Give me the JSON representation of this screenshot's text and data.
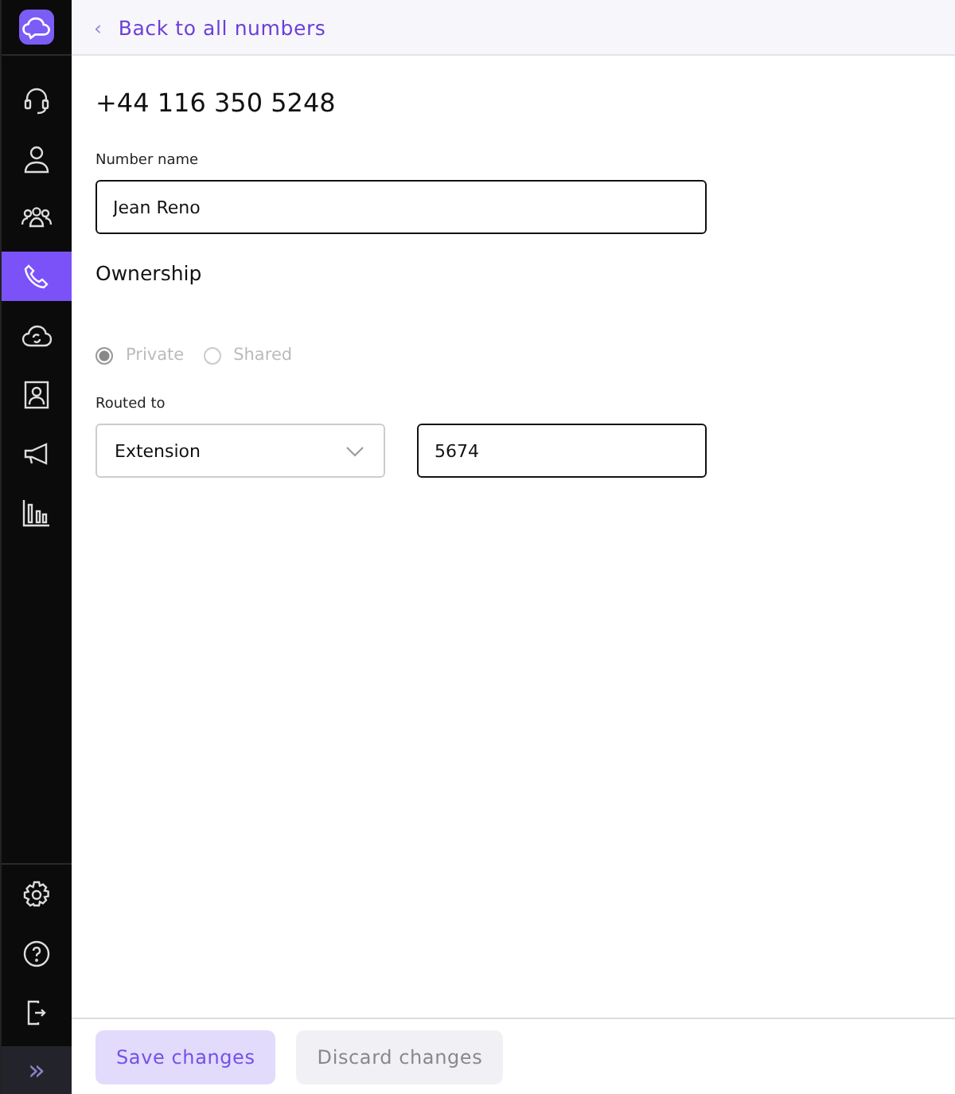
{
  "sidebar": {
    "nav": [
      {
        "kind": "headset",
        "selected": false
      },
      {
        "kind": "person",
        "selected": false
      },
      {
        "kind": "group",
        "selected": false
      },
      {
        "kind": "phone",
        "selected": true
      },
      {
        "kind": "cloud",
        "selected": false
      },
      {
        "kind": "contact",
        "selected": false
      },
      {
        "kind": "megaphone",
        "selected": false
      },
      {
        "kind": "chart",
        "selected": false
      }
    ],
    "bottom": [
      {
        "kind": "settings"
      },
      {
        "kind": "help"
      },
      {
        "kind": "logout"
      }
    ],
    "expand": "»"
  },
  "back_link": {
    "arrow": "‹",
    "label": "Back to all numbers"
  },
  "title": "+44 116 350 5248",
  "number_name": {
    "label": "Number name",
    "value": "Jean Reno"
  },
  "ownership": {
    "heading": "Ownership",
    "disabled": true,
    "options": [
      {
        "label": "Private",
        "selected": true
      },
      {
        "label": "Shared",
        "selected": false
      }
    ]
  },
  "routed_to": {
    "label": "Routed to",
    "type": "Extension",
    "value": "5674"
  },
  "buttons": [
    {
      "label": "Save changes",
      "kind": "primary"
    },
    {
      "label": "Discard changes",
      "kind": "secondary"
    }
  ]
}
